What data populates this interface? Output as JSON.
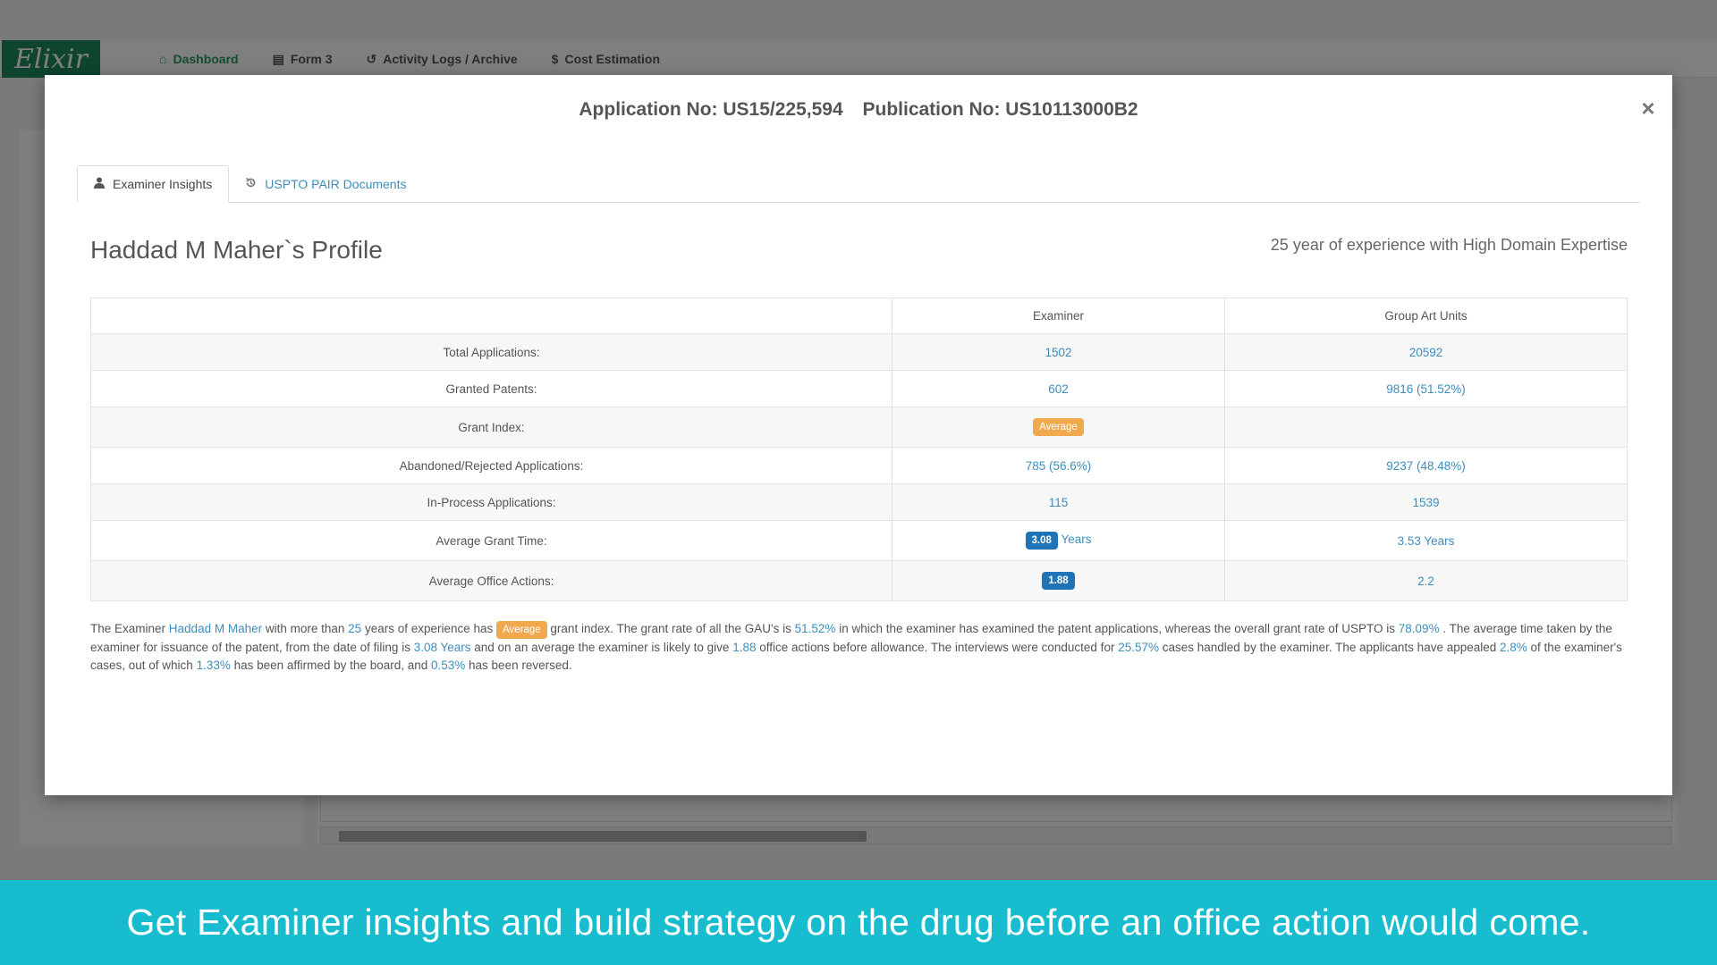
{
  "app": {
    "logo": "Elixir",
    "nav": [
      {
        "icon": "⌂",
        "label": "Dashboard"
      },
      {
        "icon": "▤",
        "label": "Form 3"
      },
      {
        "icon": "↺",
        "label": "Activity Logs / Archive"
      },
      {
        "icon": "$",
        "label": "Cost Estimation"
      }
    ]
  },
  "modal": {
    "application_no": "Application No: US15/225,594",
    "publication_no": "Publication No: US10113000B2",
    "close": "×",
    "tabs": [
      {
        "label": "Examiner Insights",
        "icon": "user-icon"
      },
      {
        "label": "USPTO PAIR Documents",
        "icon": "history-icon"
      }
    ],
    "profile_title": "Haddad M Maher`s Profile",
    "experience": "25 year of experience with High Domain Expertise",
    "table": {
      "headers": [
        "",
        "Examiner",
        "Group Art Units"
      ],
      "rows": {
        "total": {
          "label": "Total Applications:",
          "examiner": "1502",
          "gau": "20592"
        },
        "granted": {
          "label": "Granted Patents:",
          "examiner": "602",
          "gau": "9816 (51.52%)"
        },
        "grant_index": {
          "label": "Grant Index:",
          "examiner": "Average",
          "gau": ""
        },
        "abandoned": {
          "label": "Abandoned/Rejected Applications:",
          "examiner": "785 (56.6%)",
          "gau": "9237 (48.48%)"
        },
        "in_process": {
          "label": "In-Process Applications:",
          "examiner": "115",
          "gau": "1539"
        },
        "grant_time": {
          "label": "Average Grant Time:",
          "examiner": "3.08",
          "examiner_unit": "Years",
          "gau": "3.53 Years"
        },
        "office_actions": {
          "label": "Average Office Actions:",
          "examiner": "1.88",
          "gau": "2.2"
        }
      }
    },
    "summary": {
      "t1": "The Examiner ",
      "name": "Haddad M Maher",
      "t2": " with more than ",
      "years": "25",
      "t3": " years of experience has ",
      "index": "Average",
      "t4": " grant index. The grant rate of all the GAU's is ",
      "gau_rate": "51.52%",
      "t5": " in which the examiner has examined the patent applications, whereas the overall grant rate of USPTO is ",
      "uspto_rate": "78.09%",
      "t6": " . The average time taken by the examiner for issuance of the patent, from the date of filing is ",
      "time": "3.08 Years",
      "t7": " and on an average the examiner is likely to give ",
      "actions": "1.88",
      "t8": " office actions before allowance. The interviews were conducted for ",
      "interviews": "25.57%",
      "t9": " cases handled by the examiner. The applicants have appealed ",
      "appealed": "2.8%",
      "t10": " of the examiner's cases, out of which ",
      "affirmed": "1.33%",
      "t11": " has been affirmed by the board, and ",
      "reversed": "0.53%",
      "t12": " has been reversed."
    }
  },
  "banner": {
    "text": "Get Examiner insights and build strategy on the drug before an office action would come."
  },
  "colors": {
    "link": "#3c8dbc",
    "badge_orange": "#f0a94e",
    "badge_blue": "#1f74b8",
    "banner": "#18bccf",
    "brand": "#1f8a5c"
  }
}
